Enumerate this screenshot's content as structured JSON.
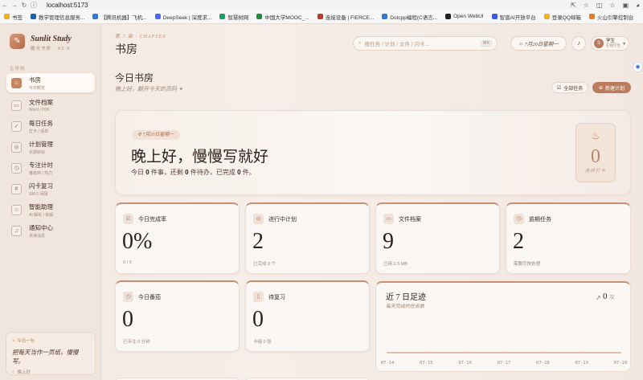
{
  "browser": {
    "url": "localhost:5173",
    "bookmarks": [
      {
        "label": "书签",
        "color": "#f2b01e"
      },
      {
        "label": "教学管理信息服务...",
        "color": "#1f5fa8"
      },
      {
        "label": "【腾讯机器】飞机...",
        "color": "#2c7cd6"
      },
      {
        "label": "DeepSeek | 深度求...",
        "color": "#4d6bfe"
      },
      {
        "label": "智慧树网",
        "color": "#1aa260"
      },
      {
        "label": "中国大学MOOC_...",
        "color": "#1f8e3d"
      },
      {
        "label": "连接设备 | FIERCE...",
        "color": "#c0392b"
      },
      {
        "label": "Dotcpp编程(C语言...",
        "color": "#2c7cd6"
      },
      {
        "label": "Open WebUI",
        "color": "#222222"
      },
      {
        "label": "智谱AI开放平台",
        "color": "#3b5bdb"
      },
      {
        "label": "登录QQ邮箱",
        "color": "#f2b01e"
      },
      {
        "label": "火山引擎控制台",
        "color": "#e67e22"
      }
    ]
  },
  "sidebar": {
    "logo_icon": "feather-icon",
    "title": "Sunlit Study",
    "version": "暖光书房 · V1.0",
    "group_label": "主导航",
    "items": [
      {
        "label": "书房",
        "sub": "今日概览",
        "icon": "home-icon",
        "glyph": "⌂",
        "active": true
      },
      {
        "label": "文件档案",
        "sub": "Word / PDF",
        "icon": "folder-icon",
        "glyph": "▭",
        "active": false
      },
      {
        "label": "每日任务",
        "sub": "打卡 / 清单",
        "icon": "checkbox-icon",
        "glyph": "✓",
        "active": false
      },
      {
        "label": "计划管理",
        "sub": "长期目标",
        "icon": "target-icon",
        "glyph": "◎",
        "active": false
      },
      {
        "label": "专注计时",
        "sub": "番茄钟 / 热力",
        "icon": "timer-icon",
        "glyph": "◷",
        "active": false
      },
      {
        "label": "闪卡复习",
        "sub": "SM-2 间隔",
        "icon": "hash-icon",
        "glyph": "#",
        "active": false
      },
      {
        "label": "智能助理",
        "sub": "AI 解析 / 拆解",
        "icon": "robot-icon",
        "glyph": "☺",
        "active": false
      },
      {
        "label": "通知中心",
        "sub": "未读消息",
        "icon": "bell-icon",
        "glyph": "♫",
        "active": false
      }
    ],
    "quote": {
      "head": "今日一句",
      "text": "把每天当作一页纸，慢慢写。",
      "foot": "晚上好"
    }
  },
  "header": {
    "chapter": "第 7 章 · CHAPTER",
    "title": "书房",
    "search_placeholder": "搜任务 / 计划 / 文件 / 闪卡...",
    "search_key": "⌘K",
    "date": "7月20日星期一",
    "user_name": "学生",
    "user_role": "在线学生",
    "avatar_letter": "S"
  },
  "overview": {
    "title": "今日书房",
    "subtitle": "晚上好，翻开今天的页码 ✦",
    "btn_all": "全部任务",
    "btn_new": "新建计划"
  },
  "hero": {
    "date_pill": "7月20日星期一",
    "greeting": "晚上好，慢慢写就好",
    "summary_prefix": "今日",
    "summary_count1": "0",
    "summary_mid1": "件事，还剩",
    "summary_count2": "0",
    "summary_mid2": "件待办，已完成",
    "summary_count3": "0",
    "summary_suffix": "件。",
    "streak_value": "0",
    "streak_label": "连续打卡"
  },
  "stats": [
    {
      "label": "今日完成率",
      "value": "0%",
      "sub": "0 / 0",
      "icon": "checklist-icon",
      "glyph": "☑"
    },
    {
      "label": "进行中计划",
      "value": "2",
      "sub": "已完成 0 个",
      "icon": "target-icon",
      "glyph": "◎"
    },
    {
      "label": "文件档案",
      "value": "9",
      "sub": "已用 2.5 MB",
      "icon": "folder-icon",
      "glyph": "▭"
    },
    {
      "label": "逾期任务",
      "value": "2",
      "sub": "需要尽快处理",
      "icon": "clock-icon",
      "glyph": "◷"
    },
    {
      "label": "今日番茄",
      "value": "0",
      "sub": "已专注 0 分钟",
      "icon": "timer-icon",
      "glyph": "◷"
    },
    {
      "label": "待复习",
      "value": "0",
      "sub": "卡组 0 张",
      "icon": "card-icon",
      "glyph": "▯"
    }
  ],
  "trend": {
    "title": "近 7 日足迹",
    "subtitle": "每天完成的任务数",
    "total": "0",
    "total_unit": "次"
  },
  "chart_data": {
    "type": "line",
    "categories": [
      "07-14",
      "07-15",
      "07-16",
      "07-17",
      "07-18",
      "07-19",
      "07-20"
    ],
    "series": [
      {
        "values": [
          0,
          0,
          0,
          0,
          0,
          0,
          0
        ]
      }
    ],
    "title": "近 7 日足迹",
    "subtitle": "每天完成的任务数",
    "color": "#d49a7c"
  },
  "colors": {
    "accent": "#bb7c5d",
    "bg": "#f4ece6"
  }
}
